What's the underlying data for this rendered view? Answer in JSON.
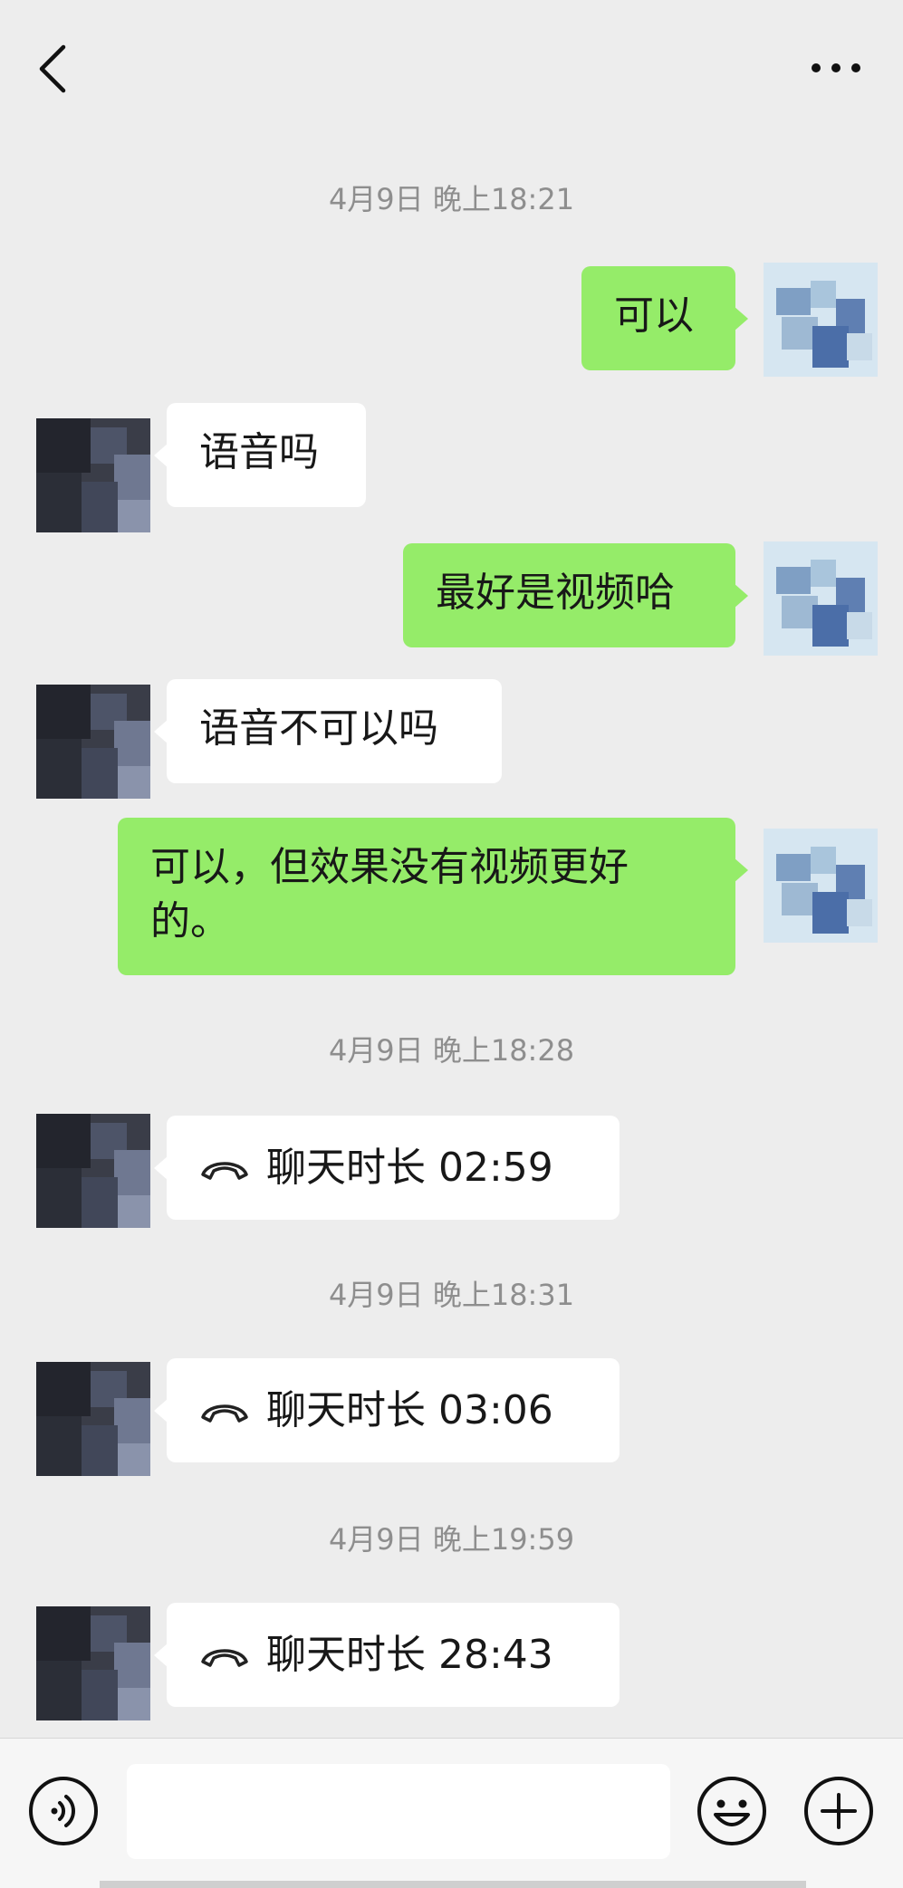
{
  "header": {
    "back_icon": "chevron-left-icon",
    "more_icon": "ellipsis-icon"
  },
  "messages": {
    "time1": "4月9日 晚上18:21",
    "m1": "可以",
    "m2": "语音吗",
    "m3": "最好是视频哈",
    "m4": "语音不可以吗",
    "m5_line1": "可以，但效果没有视频更好",
    "m5_line2": "的。",
    "time2": "4月9日 晚上18:28",
    "call1": "聊天时长 02:59",
    "time3": "4月9日 晚上18:31",
    "call2": "聊天时长 03:06",
    "time4": "4月9日 晚上19:59",
    "call3": "聊天时长 28:43"
  },
  "input_bar": {
    "voice_icon": "voice-icon",
    "emoji_icon": "emoji-icon",
    "plus_icon": "plus-icon",
    "input_value": ""
  },
  "colors": {
    "background": "#ededed",
    "sent_bubble": "#95ec69",
    "received_bubble": "#ffffff",
    "timestamp": "#8e8e8e"
  }
}
